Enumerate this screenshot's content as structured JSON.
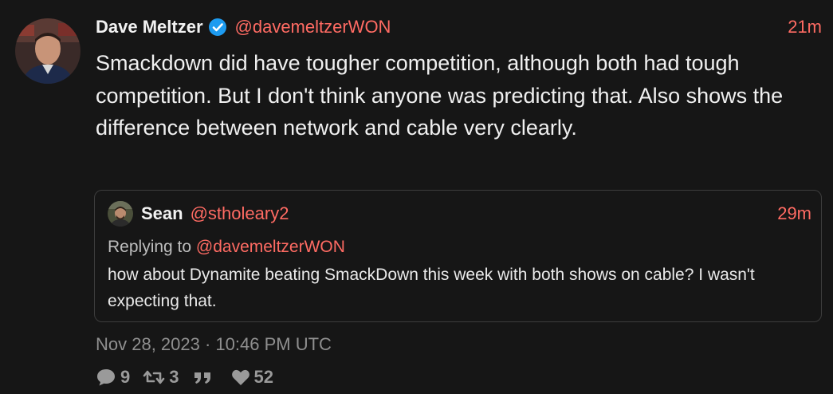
{
  "tweet": {
    "author_name": "Dave Meltzer",
    "author_handle": "@davemeltzerWON",
    "time_ago": "21m",
    "text": "Smackdown did have tougher competition, although both had tough competition.  But I don't think anyone was predicting that. Also shows the difference between network and cable very clearly.",
    "date": "Nov 28, 2023 · 10:46 PM UTC",
    "verified_icon": "verified-badge-icon"
  },
  "quote": {
    "author_name": "Sean",
    "author_handle": "@stholeary2",
    "time_ago": "29m",
    "replying_prefix": "Replying to",
    "replying_to": "@davemeltzerWON",
    "text": "how about Dynamite beating SmackDown this week with both shows on cable? I wasn't expecting that."
  },
  "stats": {
    "replies": "9",
    "retweets": "3",
    "quotes": "",
    "likes": "52"
  },
  "colors": {
    "background": "#161616",
    "accent": "#ff6b63",
    "verified": "#1d9bf0",
    "muted": "#8f8f8f",
    "border": "#3d3d3d"
  }
}
